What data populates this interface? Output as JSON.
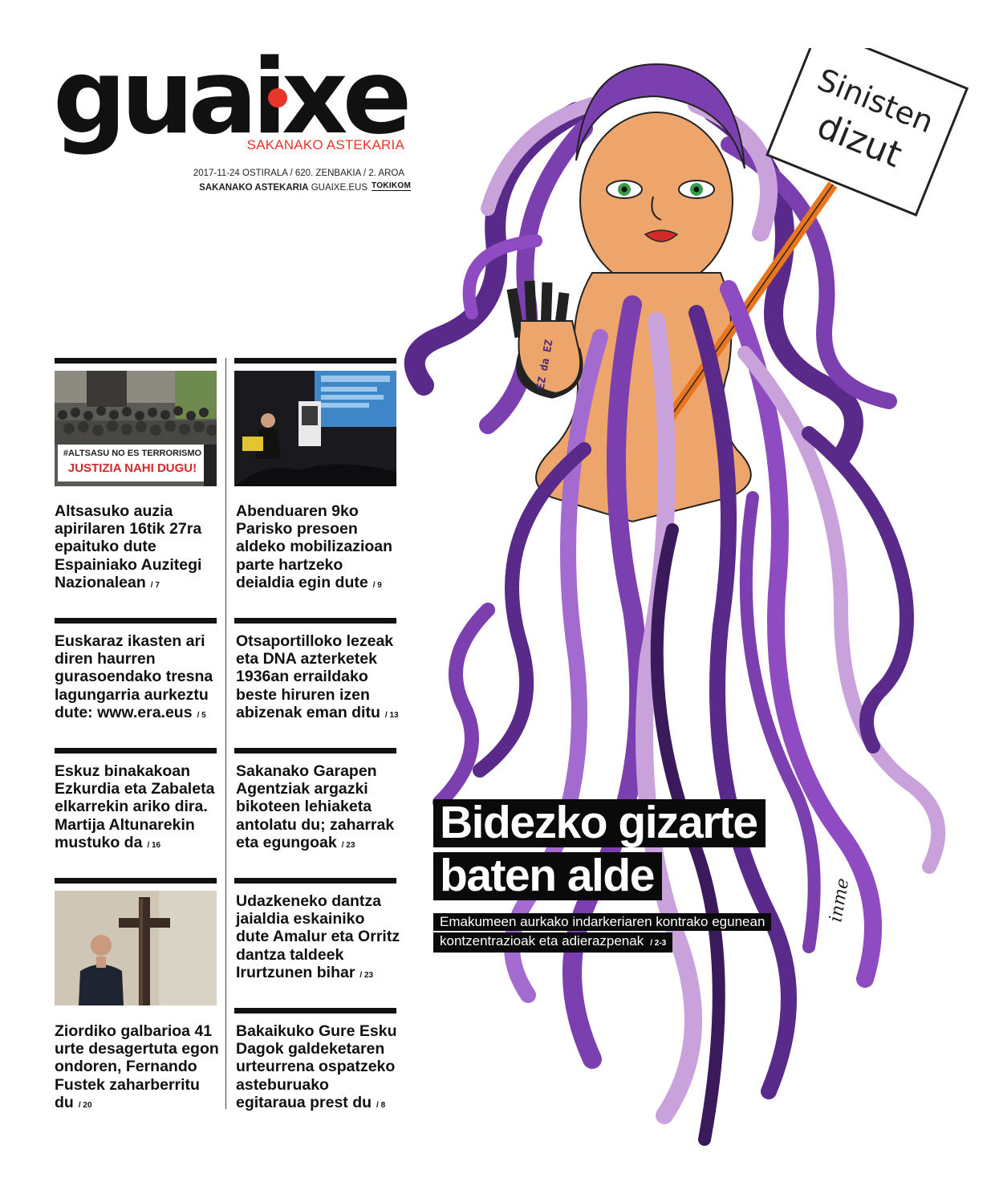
{
  "masthead": {
    "logo": "guaixe",
    "tagline": "SAKANAKO ASTEKARIA",
    "issue_line": "2017-11-24 OSTIRALA / 620. ZENBAKIA / 2. AROA",
    "site_bold": "SAKANAKO ASTEKARIA",
    "site_url": "GUAIXE.EUS",
    "partner": "TOKIKOM"
  },
  "left_column": [
    {
      "headline": "Altsasuko auzia apirilaren 16tik 27ra epaituko dute Espainiako Auzitegi Nazionalean",
      "page": "/ 7",
      "photo_banner_1": "#ALTSASU NO ES TERRORISMO",
      "photo_banner_2": "JUSTIZIA NAHI DUGU!"
    },
    {
      "headline": "Euskaraz ikasten ari diren haurren gurasoendako tresna lagungarria aurkeztu dute: www.era.eus",
      "page": "/ 5"
    },
    {
      "headline": "Eskuz binakakoan Ezkurdia eta Zabaleta elkarrekin ariko dira. Martija Altunarekin mustuko da",
      "page": "/ 16"
    },
    {
      "headline": "Ziordiko galbarioa 41 urte desagertuta egon ondoren, Fernando Fustek zaharberritu du",
      "page": "/ 20"
    }
  ],
  "right_column": [
    {
      "headline": "Abenduaren 9ko Parisko presoen aldeko mobilizazioan parte hartzeko deialdia egin dute",
      "page": "/ 9"
    },
    {
      "headline": "Otsaportilloko lezeak eta DNA azterketek 1936an erraildako beste hiruren izen abizenak eman ditu",
      "page": "/ 13"
    },
    {
      "headline": "Sakanako Garapen Agentziak argazki bikoteen lehiaketa antolatu du; zaharrak eta egungoak",
      "page": "/ 23"
    },
    {
      "headline": "Udazkeneko dantza jaialdia eskainiko dute Amalur eta Orritz dantza taldeek Irurtzunen bihar",
      "page": "/ 23"
    },
    {
      "headline": "Bakaikuko Gure Esku Dagok galdeketaren urteurrena ospatzeko asteburuako egitaraua prest du",
      "page": "/ 8"
    }
  ],
  "main_story": {
    "headline_1": "Bidezko gizarte",
    "headline_2": "baten alde",
    "subhead_1": "Emakumeen aurkako indarkeriaren kontrako egunean",
    "subhead_2": "kontzentrazioak eta adierazpenak",
    "page": "/ 2-3"
  },
  "illustration": {
    "sign_line_1": "Sinisten",
    "sign_line_2": "dizut",
    "hand_text": "EZ da EZ",
    "signature": "inme"
  },
  "colors": {
    "accent": "#e8362b",
    "purple_dark": "#5a2a8a",
    "purple": "#7b3fb0",
    "purple_light": "#c9a2dc",
    "skin": "#eda56c"
  }
}
